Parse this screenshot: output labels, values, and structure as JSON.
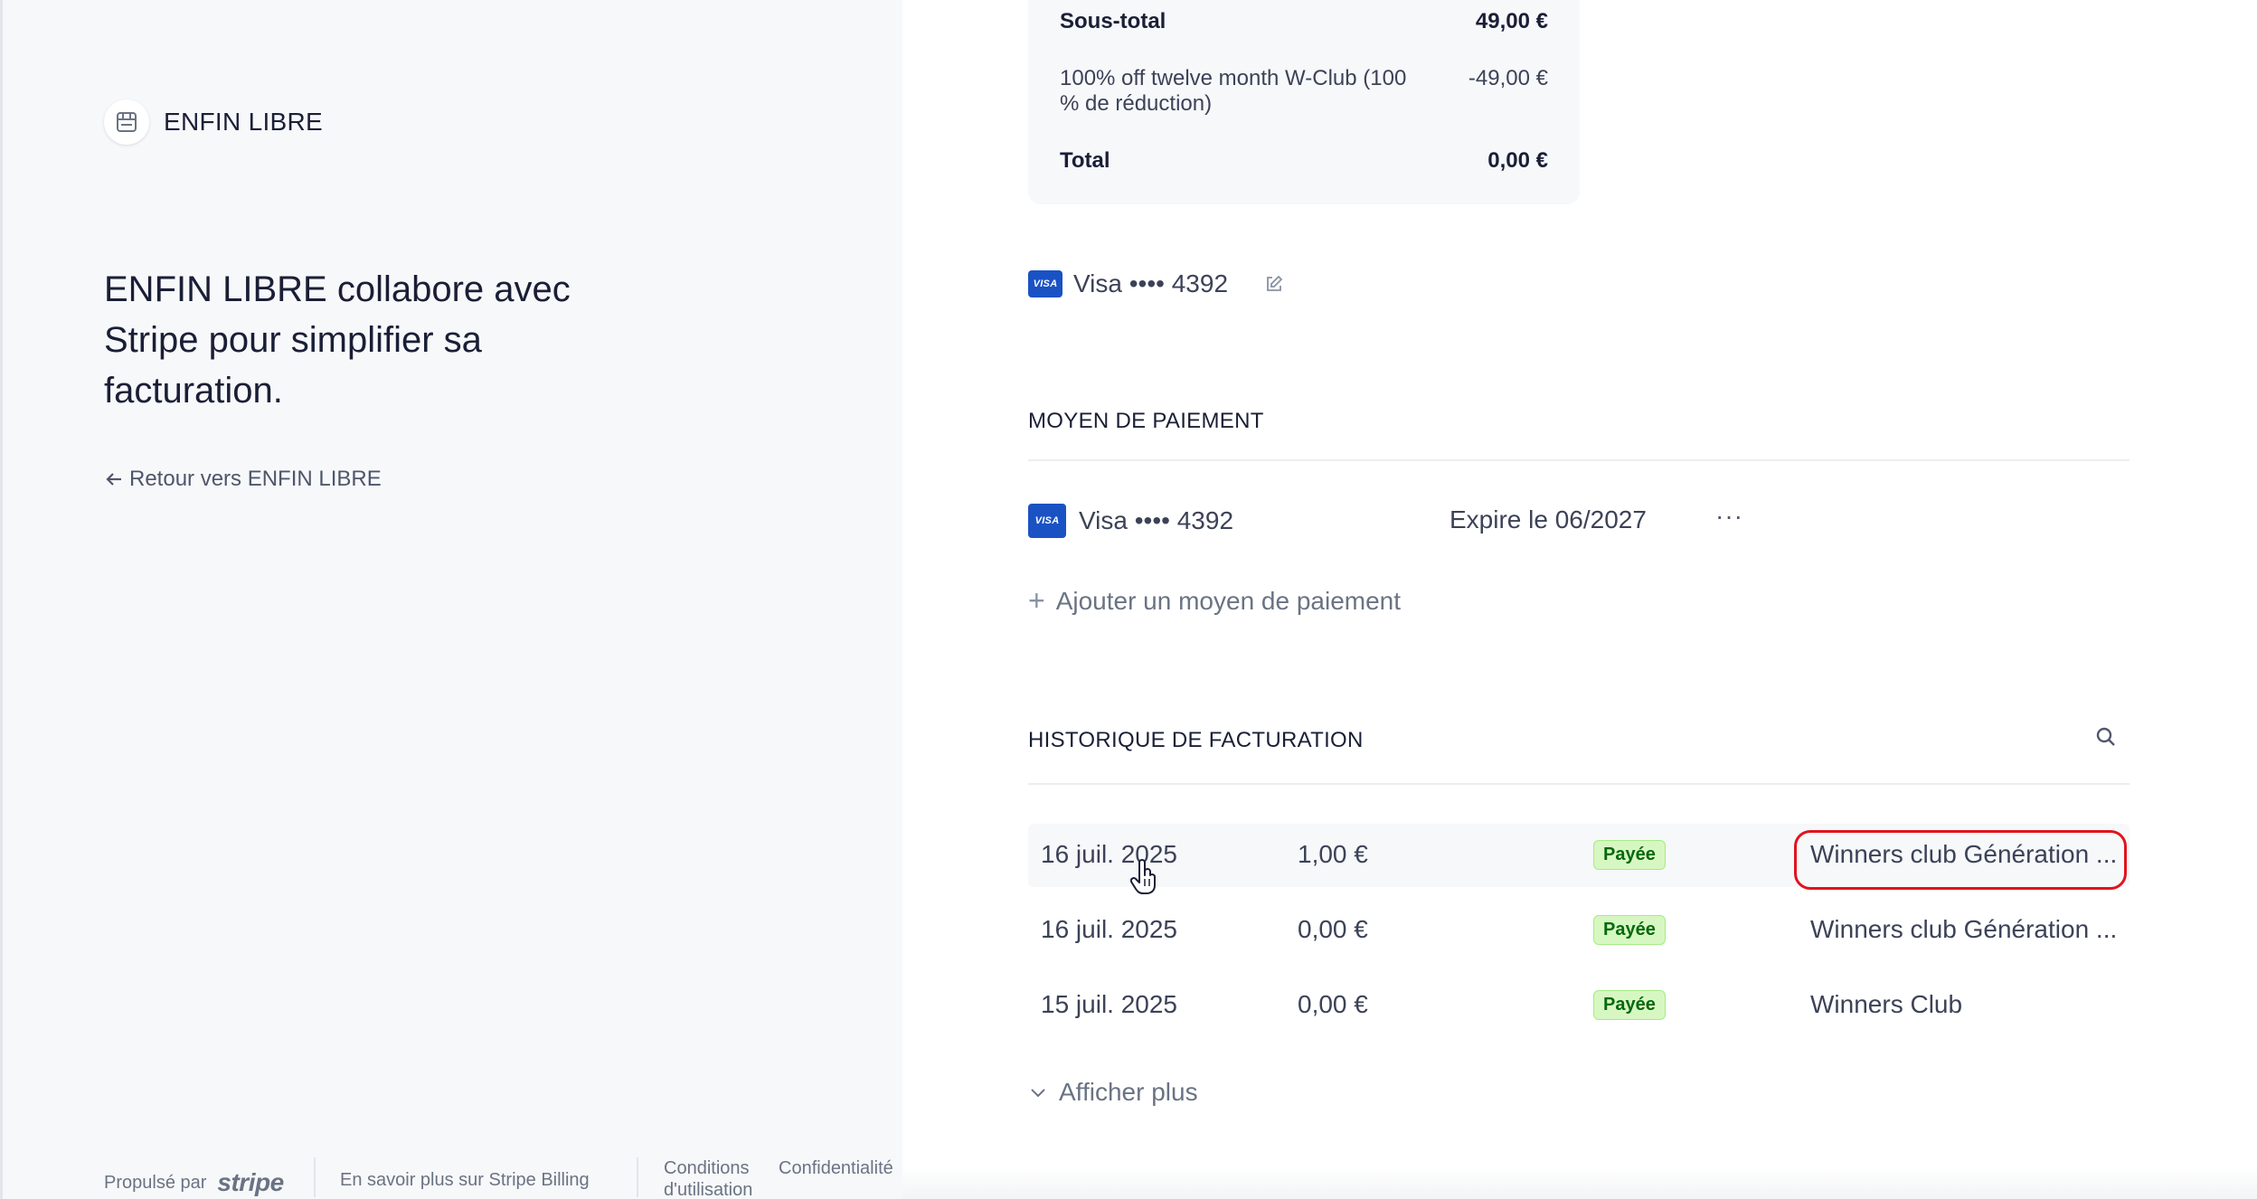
{
  "brand": {
    "name": "ENFIN LIBRE",
    "logo_icon": "store-icon"
  },
  "tagline": "ENFIN LIBRE collabore avec Stripe pour simplifier sa facturation.",
  "back_link": "Retour vers ENFIN LIBRE",
  "footer": {
    "powered_by": "Propulsé par",
    "stripe": "stripe",
    "learn_more": "En savoir plus sur Stripe Billing",
    "terms": "Conditions d'utilisation",
    "privacy": "Confidentialité"
  },
  "summary": {
    "rows": [
      {
        "label": "Sous-total",
        "value": "49,00 €"
      },
      {
        "label": "100% off twelve month W-Club (100 % de réduction)",
        "value": "-49,00 €"
      },
      {
        "label": "Total",
        "value": "0,00 €"
      }
    ]
  },
  "current_card": {
    "brand": "VISA",
    "text": "Visa •••• 4392"
  },
  "payment_methods": {
    "title": "MOYEN DE PAIEMENT",
    "items": [
      {
        "brand": "VISA",
        "text": "Visa •••• 4392",
        "expiry": "Expire le 06/2027",
        "more": "···"
      }
    ],
    "add_label": "Ajouter un moyen de paiement"
  },
  "billing_history": {
    "title": "HISTORIQUE DE FACTURATION",
    "rows": [
      {
        "date": "16 juil. 2025",
        "amount": "1,00 €",
        "status": "Payée",
        "description": "Winners club Génération ..."
      },
      {
        "date": "16 juil. 2025",
        "amount": "0,00 €",
        "status": "Payée",
        "description": "Winners club Génération ..."
      },
      {
        "date": "15 juil. 2025",
        "amount": "0,00 €",
        "status": "Payée",
        "description": "Winners Club"
      }
    ],
    "show_more": "Afficher plus"
  },
  "colors": {
    "paid_badge_bg": "#d7f7c2",
    "paid_badge_text": "#05690d",
    "highlight": "#e0141e",
    "visa_blue": "#1a52c4"
  }
}
